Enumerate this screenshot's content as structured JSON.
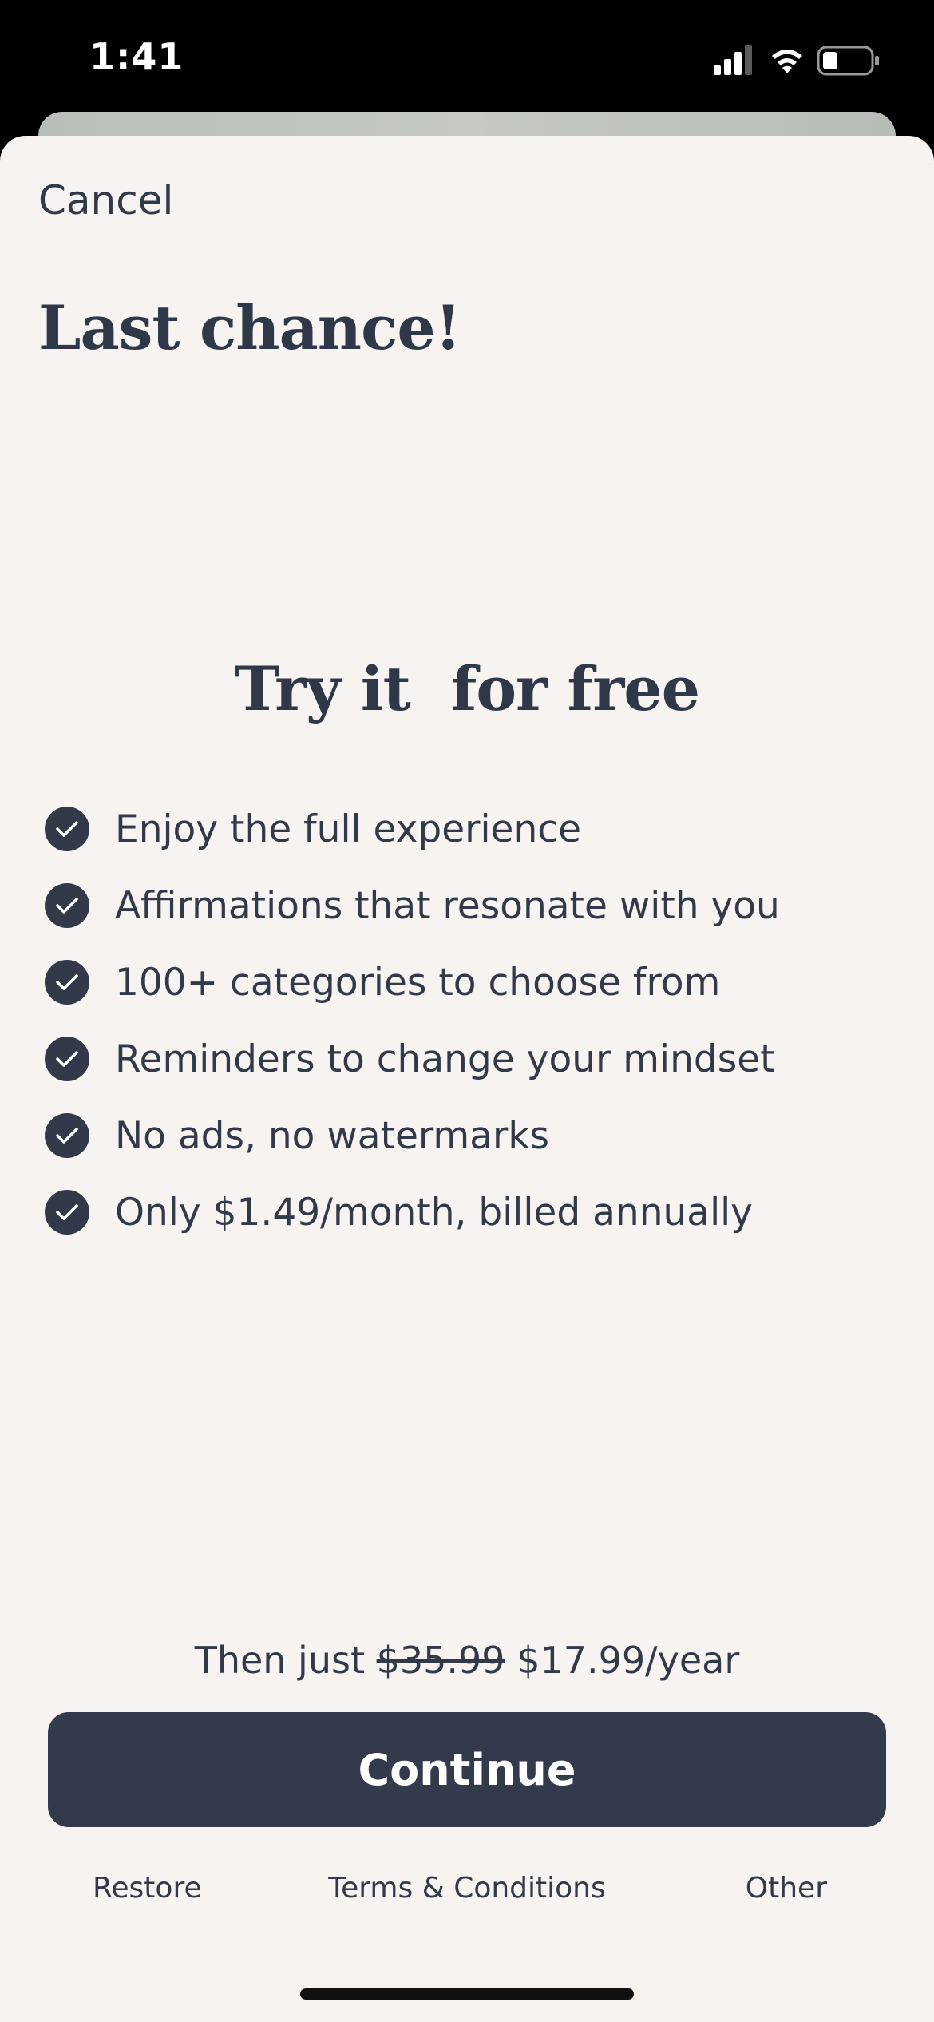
{
  "status_bar": {
    "time": "1:41",
    "icons": [
      "cellular-signal-icon",
      "wifi-icon",
      "battery-icon"
    ]
  },
  "header": {
    "cancel_label": "Cancel",
    "title": "Last chance!"
  },
  "offer": {
    "subtitle": "Try it  for free",
    "features": [
      "Enjoy the full experience",
      "Affirmations that resonate with you",
      "100+ categories to choose from",
      "Reminders to change your mindset",
      "No ads, no watermarks",
      "Only $1.49/month, billed annually"
    ],
    "feature_icon": "check-circle-icon"
  },
  "pricing": {
    "prefix": "Then just ",
    "old_price": "$35.99",
    "new_price": " $17.99/year"
  },
  "cta": {
    "continue_label": "Continue"
  },
  "footer": {
    "restore_label": "Restore",
    "terms_label": "Terms & Conditions",
    "other_label": "Other"
  },
  "colors": {
    "sheet_background": "#f6f3f1",
    "primary_dark": "#323a4b",
    "text": "#323a4a"
  }
}
